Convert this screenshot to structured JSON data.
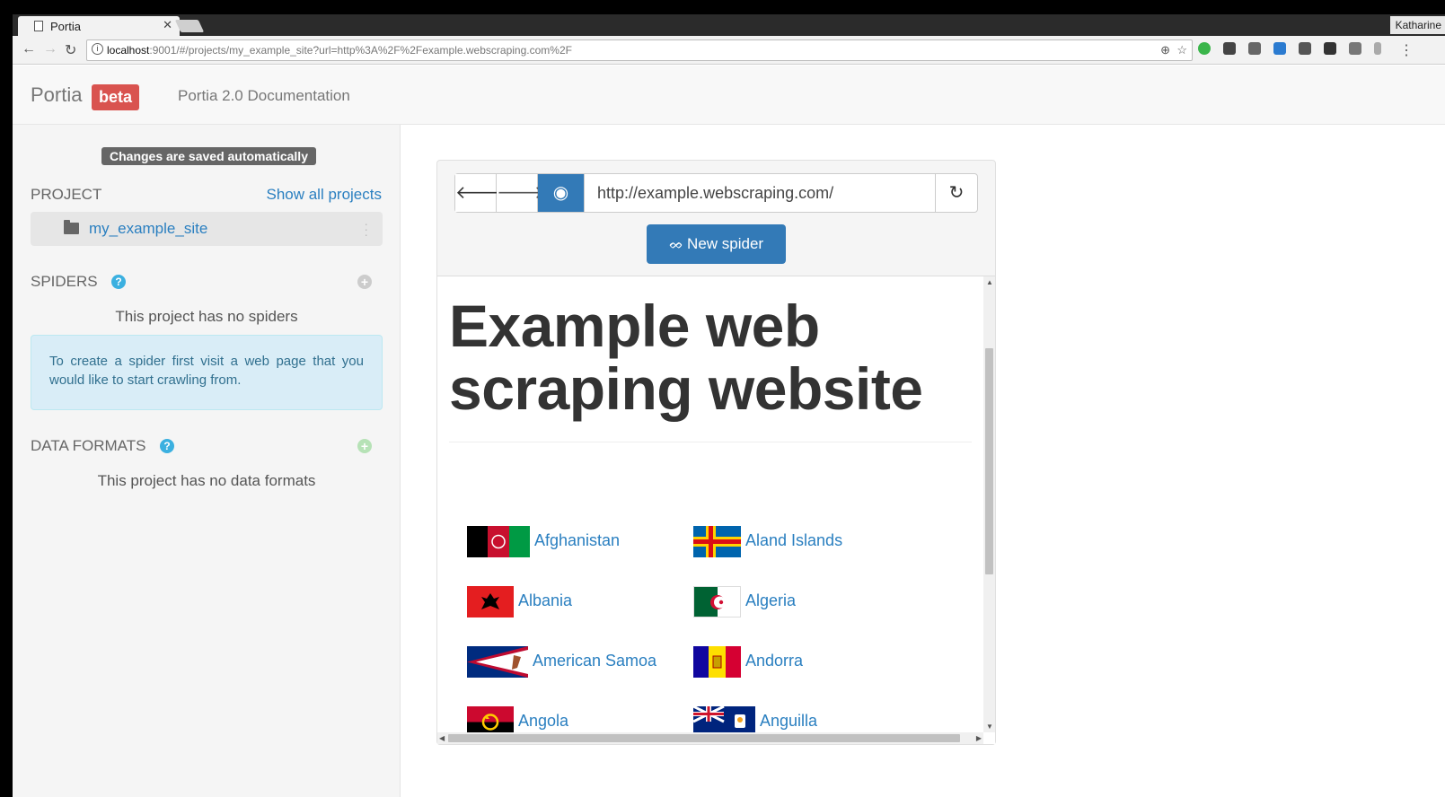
{
  "browser": {
    "tab_title": "Portia",
    "profile_name": "Katharine",
    "url_host": "localhost",
    "url_rest": ":9001/#/projects/my_example_site?url=http%3A%2F%2Fexample.webscraping.com%2F"
  },
  "navbar": {
    "brand": "Portia",
    "badge": "beta",
    "docs_link": "Portia 2.0 Documentation"
  },
  "sidebar": {
    "saved_badge": "Changes are saved automatically",
    "project_title": "PROJECT",
    "show_all": "Show all projects",
    "project_name": "my_example_site",
    "spiders_title": "SPIDERS",
    "spiders_empty": "This project has no spiders",
    "spiders_info": "To create a spider first visit a web page that you would like to start crawling from.",
    "formats_title": "DATA FORMATS",
    "formats_empty": "This project has no data formats"
  },
  "panel": {
    "url_value": "http://example.webscraping.com/",
    "new_spider_label": "New spider"
  },
  "page": {
    "heading_line1": "Example web",
    "heading_line2": "scraping website",
    "countries": [
      "Afghanistan",
      "Aland Islands",
      "Albania",
      "Algeria",
      "American Samoa",
      "Andorra",
      "Angola",
      "Anguilla"
    ]
  },
  "icons": [
    "back-icon",
    "forward-icon",
    "reload-icon",
    "info-icon",
    "zoom-icon",
    "star-icon",
    "folder-icon",
    "help-icon",
    "add-icon",
    "eye-icon",
    "spider-icon"
  ],
  "colors": {
    "accent": "#337ab7",
    "badge": "#d9534f",
    "link": "#2a7fc0",
    "info_bg": "#d9edf7"
  }
}
